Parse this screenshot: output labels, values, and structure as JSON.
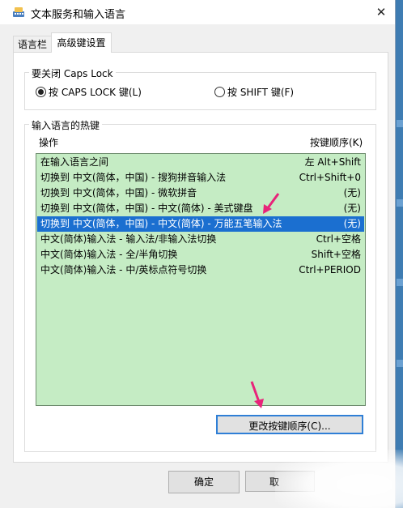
{
  "window": {
    "title": "文本服务和输入语言",
    "close_glyph": "✕"
  },
  "tabs": [
    {
      "label": "语言栏"
    },
    {
      "label": "高级键设置"
    }
  ],
  "caps_group": {
    "legend": "要关闭 Caps Lock",
    "option_caps": "按 CAPS LOCK 键(L)",
    "option_shift": "按 SHIFT 键(F)",
    "selected": "caps"
  },
  "hotkeys_group": {
    "legend": "输入语言的热键",
    "col_action": "操作",
    "col_order": "按键顺序(K)",
    "rows": [
      {
        "action": "在输入语言之间",
        "keys": "左 Alt+Shift"
      },
      {
        "action": "切换到 中文(简体，中国) - 搜狗拼音输入法",
        "keys": "Ctrl+Shift+0"
      },
      {
        "action": "切换到 中文(简体，中国) - 微软拼音",
        "keys": "(无)"
      },
      {
        "action": "切换到 中文(简体，中国) - 中文(简体) - 美式键盘",
        "keys": "(无)"
      },
      {
        "action": "切换到 中文(简体，中国) - 中文(简体) - 万能五笔输入法",
        "keys": "(无)"
      },
      {
        "action": "中文(简体)输入法 - 输入法/非输入法切换",
        "keys": "Ctrl+空格"
      },
      {
        "action": "中文(简体)输入法 - 全/半角切换",
        "keys": "Shift+空格"
      },
      {
        "action": "中文(简体)输入法 - 中/英标点符号切换",
        "keys": "Ctrl+PERIOD"
      }
    ],
    "selected_index": 4,
    "change_button": "更改按键顺序(C)..."
  },
  "footer": {
    "ok": "确定",
    "cancel": "取"
  },
  "colors": {
    "list_bg": "#c5ecc4",
    "selection": "#1b6fd0",
    "annotation_arrow": "#e8247a"
  }
}
